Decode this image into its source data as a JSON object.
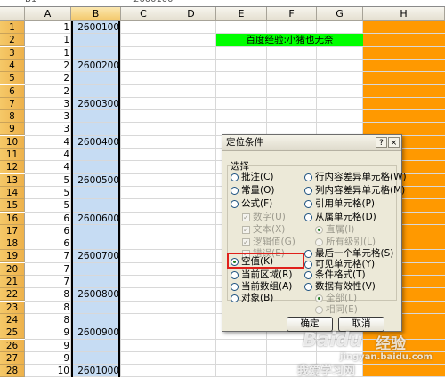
{
  "formula_bar": {
    "name_box": "B1",
    "formula": "2600100"
  },
  "columns": [
    "A",
    "B",
    "C",
    "D",
    "E",
    "F",
    "G",
    "H"
  ],
  "rows": [
    {
      "n": "1",
      "a": "1",
      "b": "2600100"
    },
    {
      "n": "2",
      "a": "1",
      "b": ""
    },
    {
      "n": "3",
      "a": "1",
      "b": ""
    },
    {
      "n": "4",
      "a": "2",
      "b": "2600200"
    },
    {
      "n": "5",
      "a": "2",
      "b": ""
    },
    {
      "n": "6",
      "a": "2",
      "b": ""
    },
    {
      "n": "7",
      "a": "3",
      "b": "2600300"
    },
    {
      "n": "8",
      "a": "3",
      "b": ""
    },
    {
      "n": "9",
      "a": "3",
      "b": ""
    },
    {
      "n": "10",
      "a": "4",
      "b": "2600400"
    },
    {
      "n": "11",
      "a": "4",
      "b": ""
    },
    {
      "n": "12",
      "a": "4",
      "b": ""
    },
    {
      "n": "13",
      "a": "5",
      "b": "2600500"
    },
    {
      "n": "14",
      "a": "5",
      "b": ""
    },
    {
      "n": "15",
      "a": "5",
      "b": ""
    },
    {
      "n": "16",
      "a": "6",
      "b": "2600600"
    },
    {
      "n": "17",
      "a": "6",
      "b": ""
    },
    {
      "n": "18",
      "a": "6",
      "b": ""
    },
    {
      "n": "19",
      "a": "7",
      "b": "2600700"
    },
    {
      "n": "20",
      "a": "7",
      "b": ""
    },
    {
      "n": "21",
      "a": "7",
      "b": ""
    },
    {
      "n": "22",
      "a": "8",
      "b": "2600800"
    },
    {
      "n": "23",
      "a": "8",
      "b": ""
    },
    {
      "n": "24",
      "a": "8",
      "b": ""
    },
    {
      "n": "25",
      "a": "9",
      "b": "2600900"
    },
    {
      "n": "26",
      "a": "9",
      "b": ""
    },
    {
      "n": "27",
      "a": "9",
      "b": ""
    },
    {
      "n": "28",
      "a": "10",
      "b": "2601000"
    }
  ],
  "green_label": "百度经验:小猪也无奈",
  "colors": {
    "orange": "#ff9900",
    "green": "#00ff00",
    "selected_column": "#c6dcf3",
    "highlight_box": "#e0201b"
  },
  "dialog": {
    "title": "定位条件",
    "help_icon": "question-icon",
    "close_icon": "close-icon",
    "group_label": "选择",
    "left_options": {
      "comments": "批注(C)",
      "constants": "常量(O)",
      "formulas": "公式(F)",
      "numbers": "数字(U)",
      "text": "文本(X)",
      "logicals": "逻辑值(G)",
      "errors": "错误(E)",
      "blanks": "空值(K)",
      "current_region": "当前区域(R)",
      "current_array": "当前数组(A)",
      "objects": "对象(B)"
    },
    "right_options": {
      "row_differences": "行内容差异单元格(W)",
      "column_differences": "列内容差异单元格(M)",
      "precedents": "引用单元格(P)",
      "dependents": "从属单元格(D)",
      "direct_only": "直属(I)",
      "all_levels": "所有级别(L)",
      "last_cell": "最后一个单元格(S)",
      "visible_cells": "可见单元格(Y)",
      "conditional_formats": "条件格式(T)",
      "data_validation": "数据有效性(V)",
      "all": "全部(L)",
      "same": "相同(E)"
    },
    "ok_label": "确定",
    "cancel_label": "取消"
  },
  "watermark": {
    "brand": "Baidu",
    "brand_suffix": "经验",
    "sub": "jingyan.baidu.com",
    "sub2": "我爱学习网"
  }
}
